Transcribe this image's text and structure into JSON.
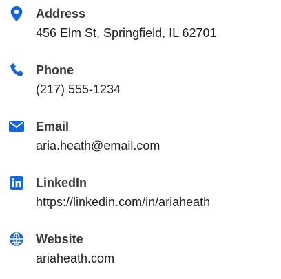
{
  "colors": {
    "icon": "#1565d8",
    "label": "#3a3a3a",
    "value": "#1f1f1f"
  },
  "contacts": [
    {
      "icon": "map-marker-icon",
      "label": "Address",
      "value": "456 Elm St, Springfield, IL 62701"
    },
    {
      "icon": "phone-icon",
      "label": "Phone",
      "value": "(217) 555-1234"
    },
    {
      "icon": "envelope-icon",
      "label": "Email",
      "value": "aria.heath@email.com"
    },
    {
      "icon": "linkedin-icon",
      "label": "LinkedIn",
      "value": "https://linkedin.com/in/ariaheath"
    },
    {
      "icon": "globe-icon",
      "label": "Website",
      "value": "ariaheath.com"
    }
  ]
}
